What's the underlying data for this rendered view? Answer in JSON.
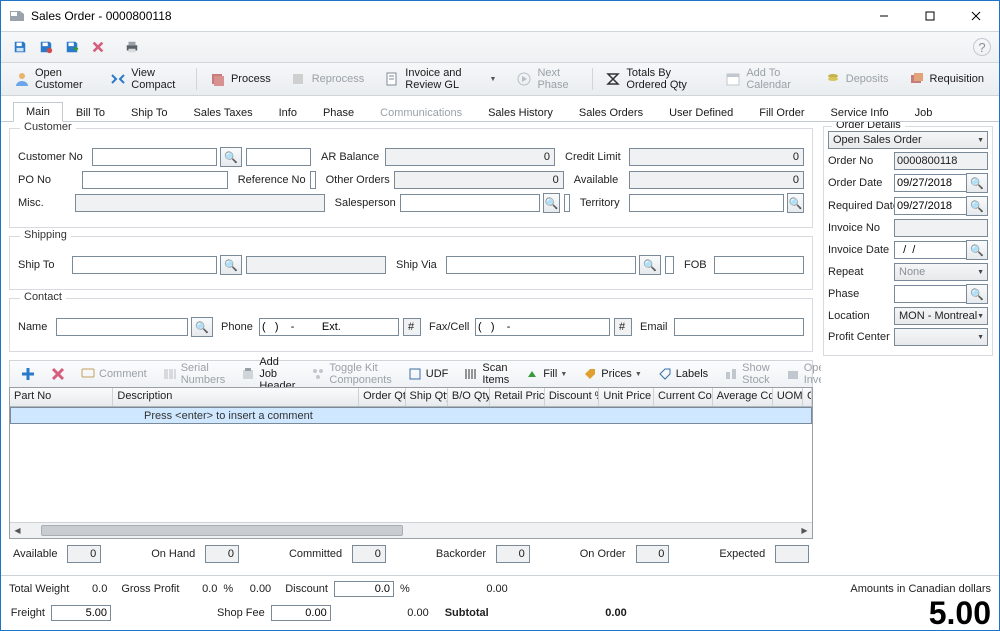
{
  "window": {
    "title": "Sales Order - 0000800118"
  },
  "ribbon": {
    "open_customer": "Open Customer",
    "view_compact": "View Compact",
    "process": "Process",
    "reprocess": "Reprocess",
    "invoice_review_gl": "Invoice and Review GL",
    "next_phase": "Next Phase",
    "totals_by_qty": "Totals By Ordered Qty",
    "add_calendar": "Add To Calendar",
    "deposits": "Deposits",
    "requisition": "Requisition"
  },
  "tabs": {
    "main": "Main",
    "bill_to": "Bill To",
    "ship_to": "Ship To",
    "sales_taxes": "Sales Taxes",
    "info": "Info",
    "phase": "Phase",
    "communications": "Communications",
    "sales_history": "Sales History",
    "sales_orders": "Sales Orders",
    "user_defined": "User Defined",
    "fill_order": "Fill Order",
    "service_info": "Service Info",
    "job": "Job"
  },
  "customer": {
    "legend": "Customer",
    "customer_no_label": "Customer No",
    "po_no_label": "PO No",
    "reference_no_label": "Reference No",
    "misc_label": "Misc.",
    "salesperson_label": "Salesperson",
    "ar_balance_label": "AR Balance",
    "ar_balance_value": "0",
    "other_orders_label": "Other Orders",
    "other_orders_value": "0",
    "credit_limit_label": "Credit Limit",
    "credit_limit_value": "0",
    "available_label": "Available",
    "available_value": "0",
    "territory_label": "Territory"
  },
  "shipping": {
    "legend": "Shipping",
    "ship_to_label": "Ship To",
    "ship_via_label": "Ship Via",
    "fob_label": "FOB"
  },
  "contact": {
    "legend": "Contact",
    "name_label": "Name",
    "phone_label": "Phone",
    "phone_value": "(   )    -         Ext.",
    "fax_label": "Fax/Cell",
    "fax_value": "(   )    -",
    "hash": "#",
    "email_label": "Email"
  },
  "order_details": {
    "legend": "Order Details",
    "status": "Open Sales Order",
    "order_no_label": "Order No",
    "order_no_value": "0000800118",
    "order_date_label": "Order Date",
    "order_date_value": "09/27/2018",
    "required_date_label": "Required Date",
    "required_date_value": "09/27/2018",
    "invoice_no_label": "Invoice No",
    "invoice_date_label": "Invoice Date",
    "invoice_date_value": "  /  /",
    "repeat_label": "Repeat",
    "repeat_value": "None",
    "phase_label": "Phase",
    "location_label": "Location",
    "location_value": "MON - Montreal",
    "profit_center_label": "Profit Center"
  },
  "itembar": {
    "comment": "Comment",
    "serial_numbers": "Serial Numbers",
    "add_job_header": "Add Job Header",
    "toggle_kit": "Toggle Kit Components",
    "udf": "UDF",
    "scan_items": "Scan Items",
    "fill": "Fill",
    "prices": "Prices",
    "labels": "Labels",
    "show_stock": "Show Stock",
    "open_inventory": "Open Inventory"
  },
  "grid": {
    "cols": {
      "part_no": "Part No",
      "description": "Description",
      "order_qty": "Order Qty",
      "ship_qty": "Ship Qty",
      "bo_qty": "B/O Qty",
      "retail_price": "Retail Price",
      "discount_pct": "Discount %",
      "unit_price": "Unit Price",
      "current_cost": "Current Cost",
      "average_cost": "Average Cost",
      "uom": "UOM",
      "conversion": "Conversi"
    },
    "placeholder_row": "Press <enter> to insert a comment"
  },
  "stock": {
    "available_label": "Available",
    "available_value": "0",
    "on_hand_label": "On Hand",
    "on_hand_value": "0",
    "committed_label": "Committed",
    "committed_value": "0",
    "backorder_label": "Backorder",
    "backorder_value": "0",
    "on_order_label": "On Order",
    "on_order_value": "0",
    "expected_label": "Expected"
  },
  "footer": {
    "total_weight_label": "Total Weight",
    "total_weight_value": "0.0",
    "gross_profit_label": "Gross Profit",
    "gross_profit_v1": "0.0",
    "gross_profit_pct": "%",
    "gross_profit_v2": "0.00",
    "discount_label": "Discount",
    "discount_value": "0.0",
    "discount_pct": "%",
    "discount_amt": "0.00",
    "freight_label": "Freight",
    "freight_value": "5.00",
    "shop_fee_label": "Shop Fee",
    "shop_fee_value": "0.00",
    "subtotal_label": "Subtotal",
    "subtotal_value": "0.00",
    "currency_note": "Amounts in Canadian dollars",
    "grand_total": "5.00"
  }
}
